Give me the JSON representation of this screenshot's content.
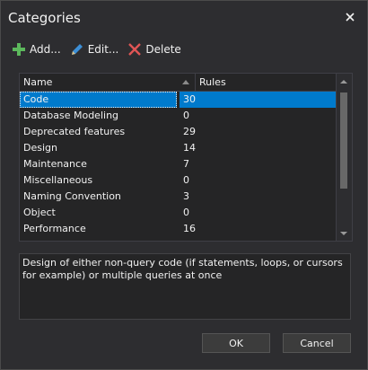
{
  "window": {
    "title": "Categories"
  },
  "toolbar": {
    "add_label": "Add...",
    "edit_label": "Edit...",
    "delete_label": "Delete"
  },
  "grid": {
    "columns": [
      "Name",
      "Rules"
    ],
    "rows": [
      {
        "name": "Code",
        "rules": "30"
      },
      {
        "name": "Database Modeling",
        "rules": "0"
      },
      {
        "name": "Deprecated features",
        "rules": "29"
      },
      {
        "name": "Design",
        "rules": "14"
      },
      {
        "name": "Maintenance",
        "rules": "7"
      },
      {
        "name": "Miscellaneous",
        "rules": "0"
      },
      {
        "name": "Naming Convention",
        "rules": "3"
      },
      {
        "name": "Object",
        "rules": "0"
      },
      {
        "name": "Performance",
        "rules": "16"
      }
    ]
  },
  "description": "Design of either non-query code (if statements, loops, or cursors for example) or multiple queries at once",
  "buttons": {
    "ok": "OK",
    "cancel": "Cancel"
  },
  "colors": {
    "selection": "#007acc",
    "background": "#2d2d30",
    "add_icon": "#5cb85c",
    "delete_icon": "#e05555",
    "edit_icon": "#3d8fd6"
  }
}
